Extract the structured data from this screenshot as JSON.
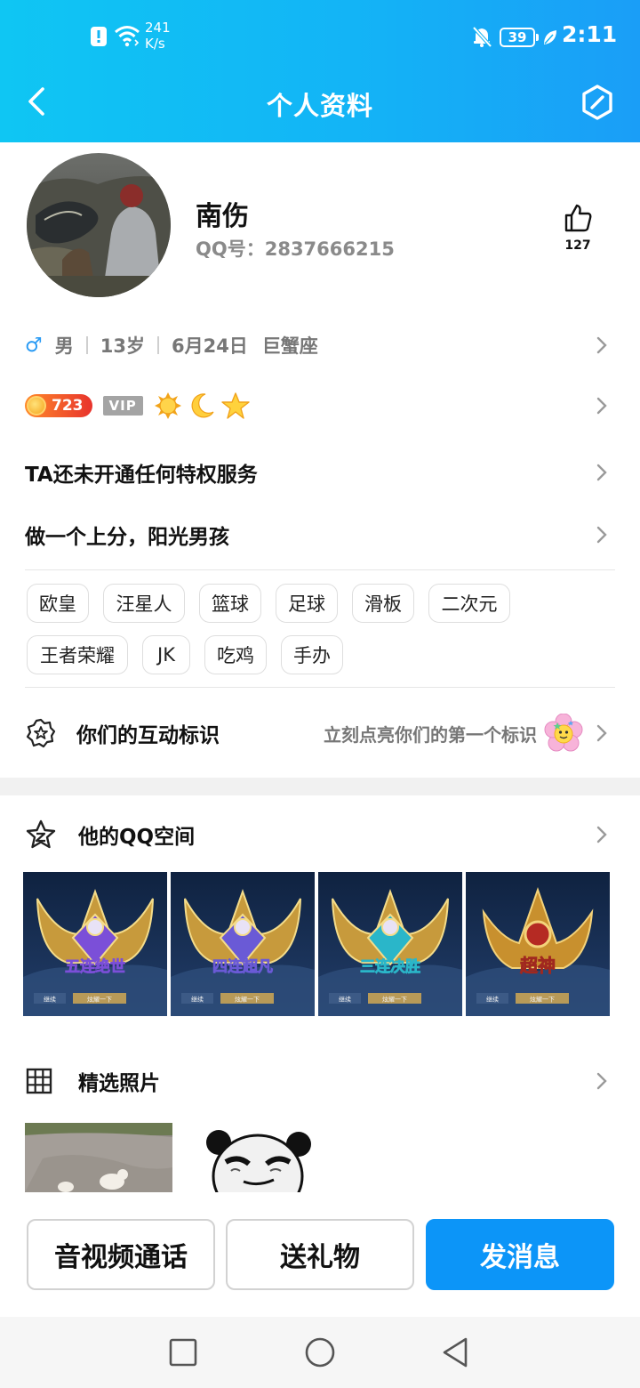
{
  "status_bar": {
    "net_speed_value": "241",
    "net_speed_unit": "K/s",
    "battery": "39",
    "time": "2:11"
  },
  "header": {
    "title": "个人资料"
  },
  "profile": {
    "nickname": "南伤",
    "qq_label": "QQ号：",
    "qq_number": "2837666215",
    "likes": "127"
  },
  "info": {
    "gender_symbol": "♂",
    "gender": "男",
    "age": "13岁",
    "birthday": "6月24日",
    "zodiac": "巨蟹座"
  },
  "badges": {
    "level": "723",
    "vip": "VIP",
    "level_icons": [
      "sun-icon",
      "moon-icon",
      "star-icon"
    ]
  },
  "privilege_text": "TA还未开通任何特权服务",
  "signature": "做一个上分，阳光男孩",
  "tags": [
    "欧皇",
    "汪星人",
    "篮球",
    "足球",
    "滑板",
    "二次元",
    "王者荣耀",
    "JK",
    "吃鸡",
    "手办"
  ],
  "interaction": {
    "title": "你们的互动标识",
    "hint": "立刻点亮你们的第一个标识"
  },
  "qzone": {
    "title": "他的QQ空间",
    "cards": [
      {
        "text": "五连绝世",
        "color": "#7b4fd8"
      },
      {
        "text": "四连超凡",
        "color": "#6a5ad6"
      },
      {
        "text": "三连决胜",
        "color": "#2ab6c9"
      },
      {
        "text": "超神",
        "color": "#d8372b"
      }
    ],
    "card_buttons": [
      "继续",
      "炫耀一下"
    ]
  },
  "photos": {
    "title": "精选照片"
  },
  "actions": {
    "call": "音视频通话",
    "gift": "送礼物",
    "message": "发消息"
  },
  "colors": {
    "header_start": "#0fc6f3",
    "header_end": "#1a9ef7",
    "primary_button": "#0c95f8",
    "male": "#2a9bf4"
  }
}
